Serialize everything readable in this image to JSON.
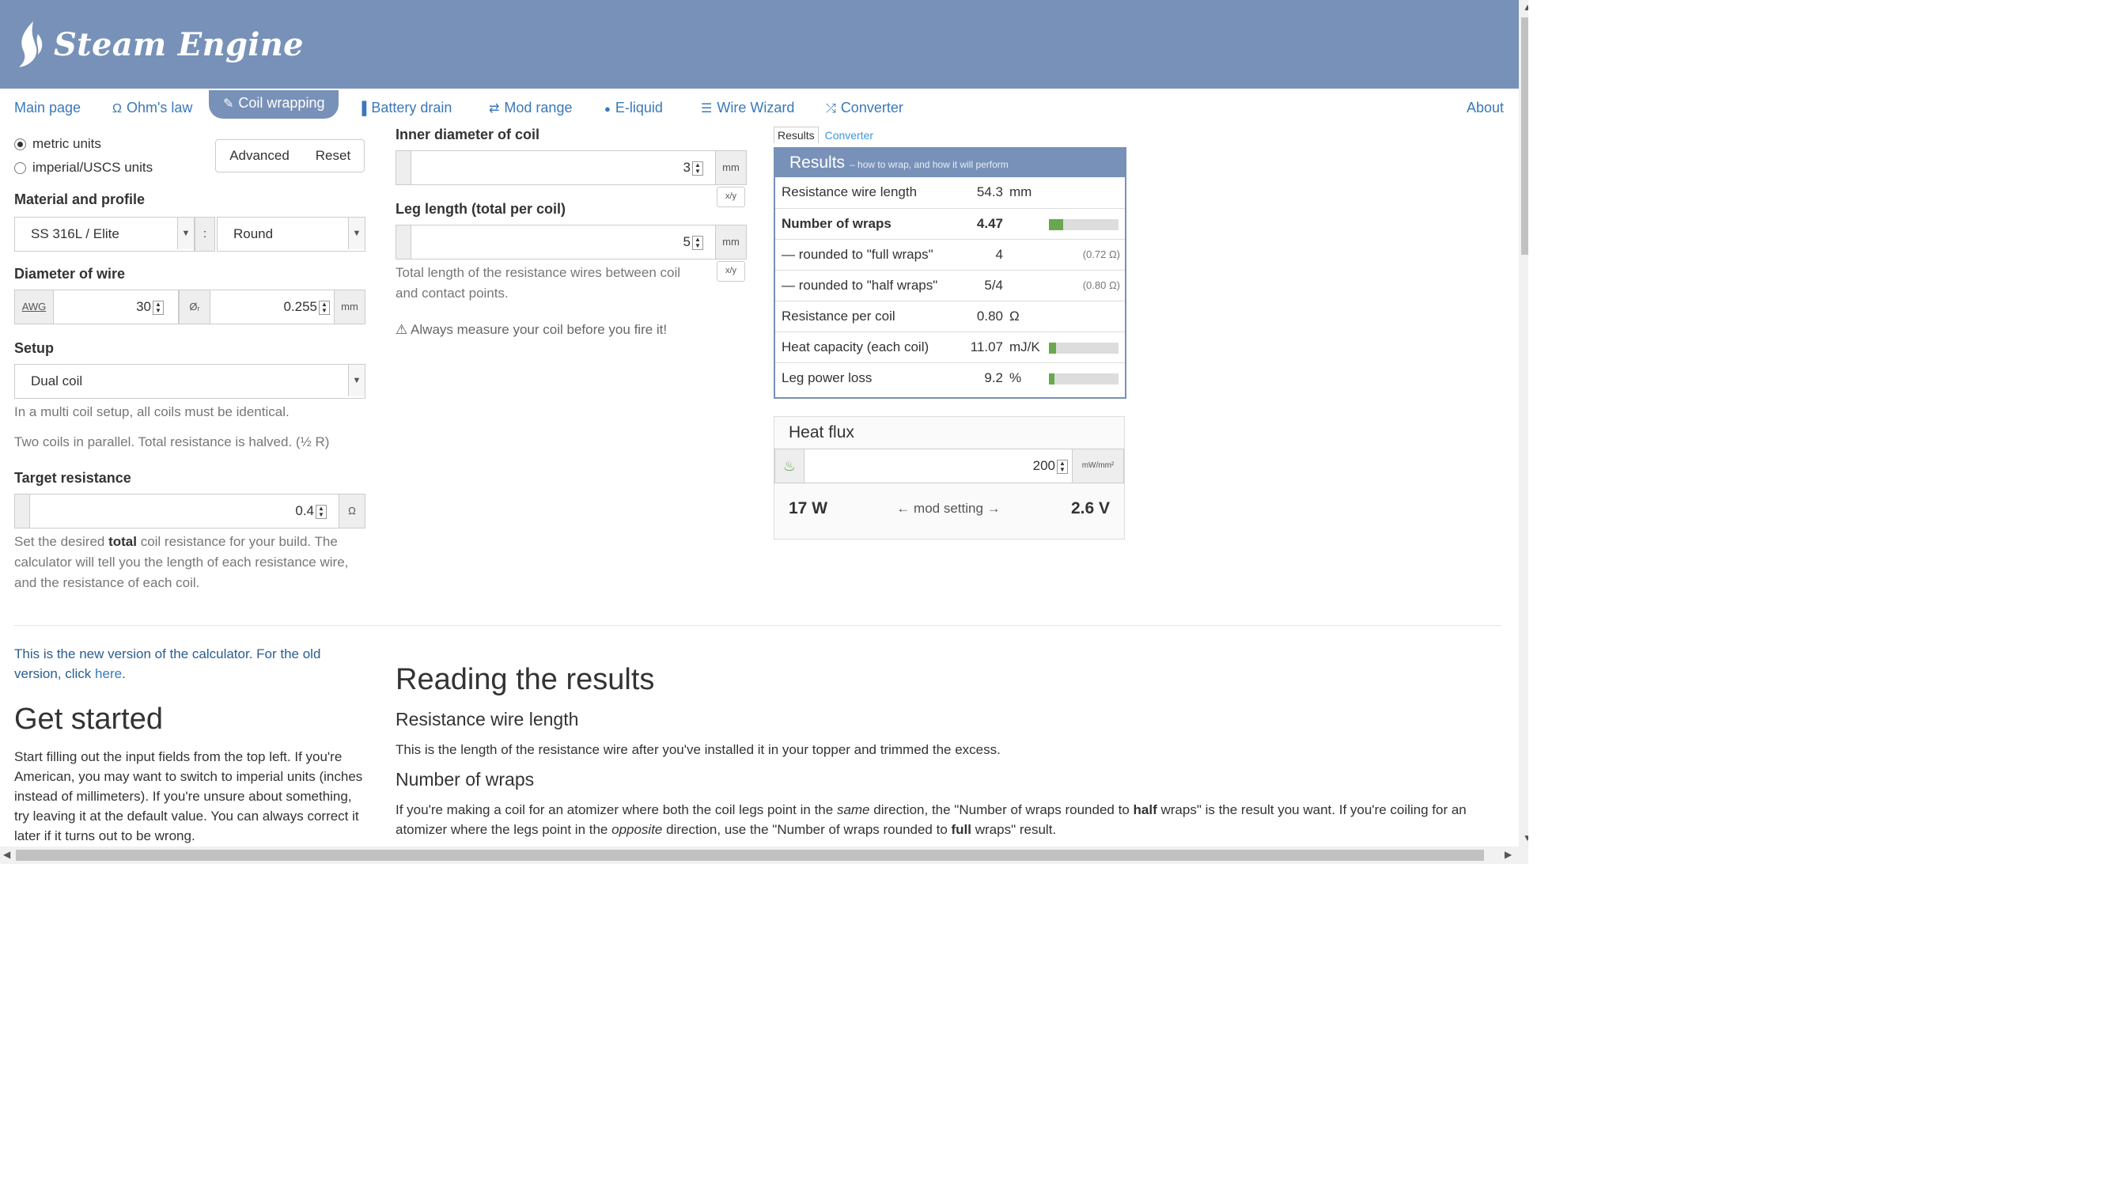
{
  "app": {
    "title": "Steam Engine"
  },
  "nav": {
    "items": [
      {
        "label": "Main page",
        "icon": ""
      },
      {
        "label": "Ohm's law",
        "icon": "Ω"
      },
      {
        "label": "Coil wrapping",
        "icon": "✎"
      },
      {
        "label": "Battery drain",
        "icon": "▐"
      },
      {
        "label": "Mod range",
        "icon": "⇄"
      },
      {
        "label": "E-liquid",
        "icon": "💧"
      },
      {
        "label": "Wire Wizard",
        "icon": "☰"
      },
      {
        "label": "Converter",
        "icon": "⤮"
      }
    ],
    "about": "About",
    "active": "Coil wrapping"
  },
  "units": {
    "metric": "metric units",
    "imperial": "imperial/USCS units",
    "selected": "metric"
  },
  "buttons": {
    "advanced": "Advanced",
    "reset": "Reset"
  },
  "material": {
    "label": "Material and profile",
    "material_value": "SS 316L / Elite",
    "separator": ":",
    "profile_value": "Round"
  },
  "diameter": {
    "label": "Diameter of wire",
    "awg_addon": "AWG",
    "awg_value": "30",
    "dia_addon": "Øᵣ",
    "dia_value": "0.255",
    "unit": "mm"
  },
  "setup": {
    "label": "Setup",
    "value": "Dual coil",
    "note1": "In a multi coil setup, all coils must be identical.",
    "note2": "Two coils in parallel. Total resistance is halved. (½ R)"
  },
  "target": {
    "label": "Target resistance",
    "value": "0.4",
    "unit": "Ω",
    "help_pre": "Set the desired ",
    "help_bold": "total",
    "help_post": " coil resistance for your build. The calculator will tell you the length of each resistance wire, and the resistance of each coil."
  },
  "inner": {
    "label": "Inner diameter of coil",
    "value": "3",
    "unit": "mm",
    "toggle": "x/y"
  },
  "leg": {
    "label": "Leg length (total per coil)",
    "value": "5",
    "unit": "mm",
    "toggle": "x/y",
    "note": "Total length of the resistance wires between coil and contact points."
  },
  "warning": {
    "text": "Always measure your coil before you fire it!"
  },
  "result_tabs": {
    "results": "Results",
    "converter": "Converter"
  },
  "results": {
    "title": "Results",
    "subtitle": "– how to wrap, and how it will perform",
    "rows": [
      {
        "name": "Resistance wire length",
        "value": "54.3",
        "unit": "mm",
        "extra": ""
      },
      {
        "name": "Number of wraps",
        "value": "4.47",
        "unit": "",
        "extra": ""
      },
      {
        "name": "— rounded to \"full wraps\"",
        "value": "4",
        "unit": "",
        "extra": "(0.72 Ω)"
      },
      {
        "name": "— rounded to \"half wraps\"",
        "value": "5/4",
        "unit": "",
        "extra": "(0.80 Ω)"
      },
      {
        "name": "Resistance per coil",
        "value": "0.80",
        "unit": "Ω",
        "extra": ""
      },
      {
        "name": "Heat capacity (each coil)",
        "value": "11.07",
        "unit": "mJ/K",
        "extra": ""
      },
      {
        "name": "Leg power loss",
        "value": "9.2",
        "unit": "%",
        "extra": ""
      }
    ],
    "bars": {
      "wraps": 0.2,
      "heat_capacity": 0.1,
      "leg_loss": 0.08
    }
  },
  "heatflux": {
    "title": "Heat flux",
    "value": "200",
    "unit": "mW/mm²",
    "watts": "17 W",
    "mid": "← mod setting →",
    "volts": "2.6 V"
  },
  "lower": {
    "notice_pre": "This is the new version of the calculator. For the old version, click ",
    "notice_link": "here",
    "notice_post": ".",
    "get_started": "Get started",
    "get_started_text": "Start filling out the input fields from the top left. If you're American, you may want to switch to imperial units (inches instead of millimeters). If you're unsure about something, try leaving it at the default value. You can always correct it later if it turns out to be wrong.",
    "reading": "Reading the results",
    "rw_heading": "Resistance wire length",
    "rw_text": "This is the length of the resistance wire after you've installed it in your topper and trimmed the excess.",
    "nw_heading": "Number of wraps",
    "nw_p1": "If you're making a coil for an atomizer where both the coil legs point in the ",
    "nw_same": "same",
    "nw_p2": " direction, the \"Number of wraps rounded to ",
    "nw_half": "half",
    "nw_p3": " wraps\" is the result you want. If you're coiling for an atomizer where the legs point in the ",
    "nw_opposite": "opposite",
    "nw_p4": " direction, use the \"Number of wraps rounded to ",
    "nw_full": "full",
    "nw_p5": " wraps\" result."
  }
}
